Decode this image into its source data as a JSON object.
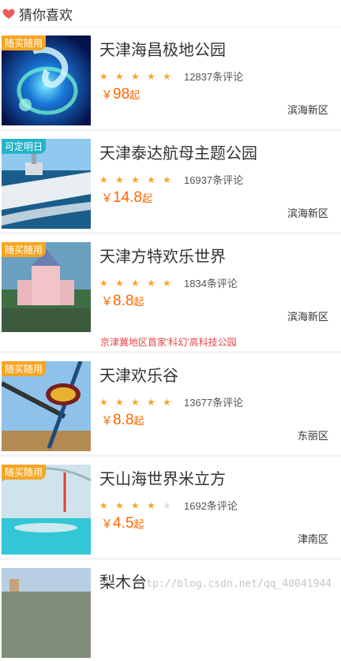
{
  "header": {
    "title": "猜你喜欢"
  },
  "items": [
    {
      "tag": "随买随用",
      "tag_color": "#f5a623",
      "title": "天津海昌极地公园",
      "stars": 5,
      "reviews": "12837条评论",
      "currency": "￥",
      "price": "98",
      "unit": "起",
      "district": "滨海新区",
      "promo": ""
    },
    {
      "tag": "可定明日",
      "tag_color": "#24b3c9",
      "title": "天津泰达航母主题公园",
      "stars": 5,
      "reviews": "16937条评论",
      "currency": "￥",
      "price": "14.8",
      "unit": "起",
      "district": "滨海新区",
      "promo": ""
    },
    {
      "tag": "随买随用",
      "tag_color": "#f5a623",
      "title": "天津方特欢乐世界",
      "stars": 5,
      "reviews": "1834条评论",
      "currency": "￥",
      "price": "8.8",
      "unit": "起",
      "district": "滨海新区",
      "promo": "京津冀地区首家'科幻'高科技公园"
    },
    {
      "tag": "随买随用",
      "tag_color": "#f5a623",
      "title": "天津欢乐谷",
      "stars": 5,
      "reviews": "13677条评论",
      "currency": "￥",
      "price": "8.8",
      "unit": "起",
      "district": "东丽区",
      "promo": ""
    },
    {
      "tag": "随买随用",
      "tag_color": "#f5a623",
      "title": "天山海世界米立方",
      "stars": 4,
      "reviews": "1692条评论",
      "currency": "￥",
      "price": "4.5",
      "unit": "起",
      "district": "津南区",
      "promo": ""
    },
    {
      "tag": "",
      "tag_color": "#f5a623",
      "title": "梨木台",
      "stars": 0,
      "reviews": "",
      "currency": "",
      "price": "",
      "unit": "",
      "district": "",
      "promo": ""
    }
  ],
  "watermark": "http://blog.csdn.net/qq_40041944",
  "colors": {
    "accent": "#ff6600",
    "star": "#f5a623",
    "promo": "#e6464a"
  }
}
